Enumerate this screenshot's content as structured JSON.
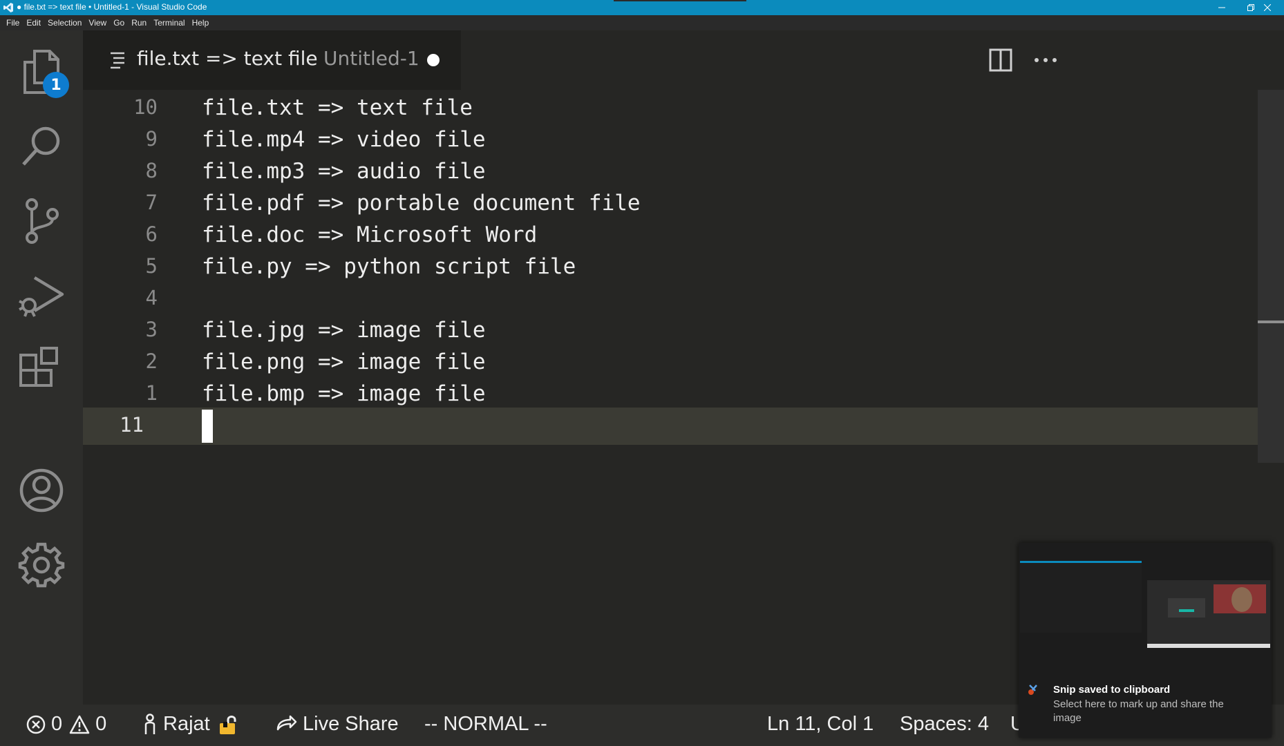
{
  "window": {
    "title": "● file.txt => text file • Untitled-1 - Visual Studio Code"
  },
  "menu": [
    "File",
    "Edit",
    "Selection",
    "View",
    "Go",
    "Run",
    "Terminal",
    "Help"
  ],
  "activity_bar": {
    "explorer_badge": "1",
    "items": [
      "explorer-icon",
      "search-icon",
      "source-control-icon",
      "run-debug-icon",
      "extensions-icon",
      "accounts-icon",
      "settings-gear-icon"
    ]
  },
  "tab": {
    "title": "file.txt => text file",
    "description": "Untitled-1",
    "dirty": true
  },
  "editor": {
    "lines": [
      {
        "number": "10",
        "text": "file.txt => text file"
      },
      {
        "number": "9",
        "text": "file.mp4 => video file"
      },
      {
        "number": "8",
        "text": "file.mp3 => audio file"
      },
      {
        "number": "7",
        "text": "file.pdf => portable document file"
      },
      {
        "number": "6",
        "text": "file.doc => Microsoft Word"
      },
      {
        "number": "5",
        "text": "file.py => python script file"
      },
      {
        "number": "4",
        "text": ""
      },
      {
        "number": "3",
        "text": "file.jpg => image file"
      },
      {
        "number": "2",
        "text": "file.png => image file"
      },
      {
        "number": "1",
        "text": "file.bmp => image file"
      },
      {
        "number": "11",
        "text": ""
      }
    ]
  },
  "status": {
    "errors": "0",
    "warnings": "0",
    "user": "Rajat",
    "live_share": "Live Share",
    "vim_mode": "-- NORMAL --",
    "cursor": "Ln 11, Col 1",
    "spaces": "Spaces: 4",
    "encoding_partial": "U"
  },
  "toast": {
    "title": "Snip saved to clipboard",
    "body": "Select here to mark up and share the image"
  },
  "colors": {
    "titlebar": "#0b8bbd",
    "editor_bg": "#262624",
    "badge": "#0e7ccf"
  }
}
